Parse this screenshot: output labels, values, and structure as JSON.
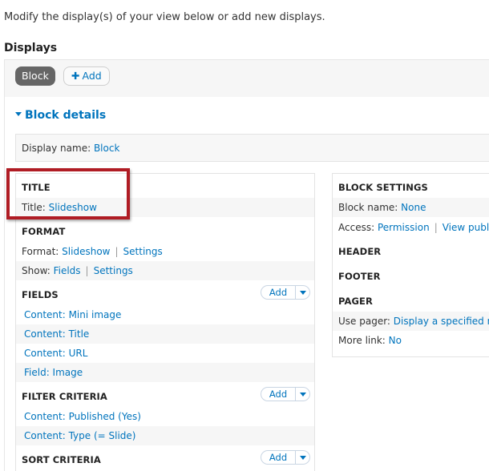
{
  "intro": "Modify the display(s) of your view below or add new displays.",
  "displays_heading": "Displays",
  "tabs": {
    "block_label": "Block",
    "add_icon": "plus-icon",
    "add_label": "Add"
  },
  "details": {
    "heading": "Block details",
    "display_name_label": "Display name:",
    "display_name_value": "Block"
  },
  "left": {
    "title": {
      "heading": "TITLE",
      "label": "Title:",
      "value": "Slideshow"
    },
    "format": {
      "heading": "FORMAT",
      "format_label": "Format:",
      "format_value": "Slideshow",
      "format_settings": "Settings",
      "show_label": "Show:",
      "show_value": "Fields",
      "show_settings": "Settings"
    },
    "fields": {
      "heading": "FIELDS",
      "add_label": "Add",
      "items": [
        "Content: Mini image",
        "Content: Title",
        "Content: URL",
        "Field: Image"
      ]
    },
    "filter": {
      "heading": "FILTER CRITERIA",
      "add_label": "Add",
      "items": [
        "Content: Published (Yes)",
        "Content: Type (= Slide)"
      ]
    },
    "sort": {
      "heading": "SORT CRITERIA",
      "add_label": "Add"
    }
  },
  "right": {
    "block_settings": {
      "heading": "BLOCK SETTINGS",
      "block_name_label": "Block name:",
      "block_name_value": "None",
      "access_label": "Access:",
      "access_value": "Permission",
      "access_view": "View publ"
    },
    "header_heading": "HEADER",
    "footer_heading": "FOOTER",
    "pager": {
      "heading": "PAGER",
      "use_pager_label": "Use pager:",
      "use_pager_value": "Display a specified nu",
      "more_link_label": "More link:",
      "more_link_value": "No"
    }
  },
  "colors": {
    "link": "#0074bd",
    "highlight": "#b01c24",
    "tab_active": "#666666"
  }
}
